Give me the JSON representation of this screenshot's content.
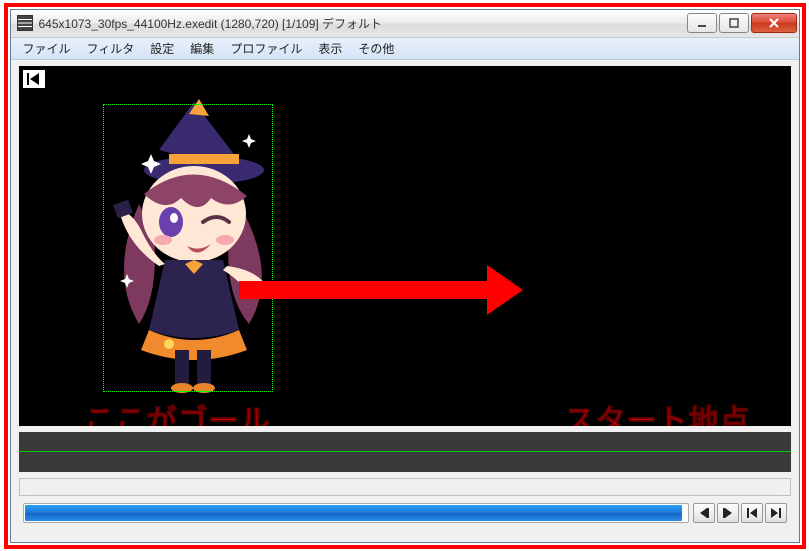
{
  "window": {
    "title": "645x1073_30fps_44100Hz.exedit (1280,720)  [1/109]  デフォルト"
  },
  "menu": {
    "file": "ファイル",
    "filter": "フィルタ",
    "settings": "設定",
    "edit": "編集",
    "profile": "プロファイル",
    "view": "表示",
    "other": "その他"
  },
  "annotations": {
    "goal": "ここがゴール",
    "start": "スタート地点"
  }
}
